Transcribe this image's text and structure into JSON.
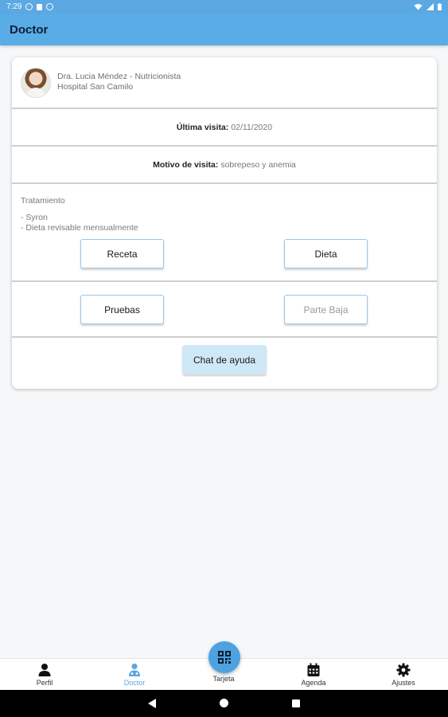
{
  "status_bar": {
    "time": "7:29"
  },
  "app_bar": {
    "title": "Doctor"
  },
  "doctor_card": {
    "doctor_name": "Dra. Lucia Méndez - Nutricionista",
    "hospital": "Hospital San Camilo",
    "last_visit_label": "Última visita:",
    "last_visit_value": "02/11/2020",
    "reason_label": "Motivo de visita:",
    "reason_value": "sobrepeso y anemia",
    "treatment_title": "Tratamiento",
    "treatment_items": [
      "- Syron",
      "- Dieta revisable mensualmente"
    ]
  },
  "buttons": {
    "receta": "Receta",
    "dieta": "Dieta",
    "pruebas": "Pruebas",
    "parte_baja": "Parte Baja",
    "chat": "Chat de ayuda"
  },
  "bottom_nav": {
    "items": [
      {
        "label": "Perfil",
        "icon": "person-icon",
        "active": false
      },
      {
        "label": "Doctor",
        "icon": "doctor-icon",
        "active": true
      },
      {
        "label": "Tarjeta",
        "icon": "qr-code-icon",
        "active": false
      },
      {
        "label": "Agenda",
        "icon": "calendar-icon",
        "active": false
      },
      {
        "label": "Ajustes",
        "icon": "gear-icon",
        "active": false
      }
    ]
  },
  "colors": {
    "app_bar": "#5aace6",
    "accent": "#5aa6e0",
    "chat_button": "#cfe8f8",
    "system_nav": "#000000"
  }
}
